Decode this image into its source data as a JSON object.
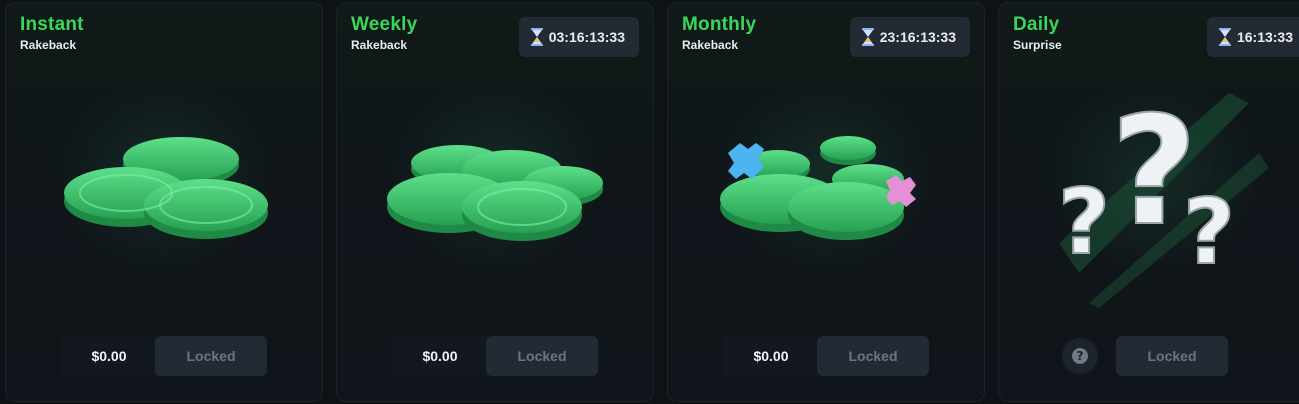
{
  "cards": [
    {
      "title": "Instant",
      "subtitle": "Rakeback",
      "timer": null,
      "amount": "$0.00",
      "button": "Locked"
    },
    {
      "title": "Weekly",
      "subtitle": "Rakeback",
      "timer": "03:16:13:33",
      "amount": "$0.00",
      "button": "Locked"
    },
    {
      "title": "Monthly",
      "subtitle": "Rakeback",
      "timer": "23:16:13:33",
      "amount": "$0.00",
      "button": "Locked"
    },
    {
      "title": "Daily",
      "subtitle": "Surprise",
      "timer": "16:13:33",
      "amount": null,
      "button": "Locked"
    }
  ],
  "icons": {
    "timer": "hourglass-icon",
    "help": "question-icon"
  },
  "colors": {
    "accent": "#39d65a",
    "coin": "#3ec46a",
    "panel": "#10151b",
    "button": "#222a34"
  }
}
